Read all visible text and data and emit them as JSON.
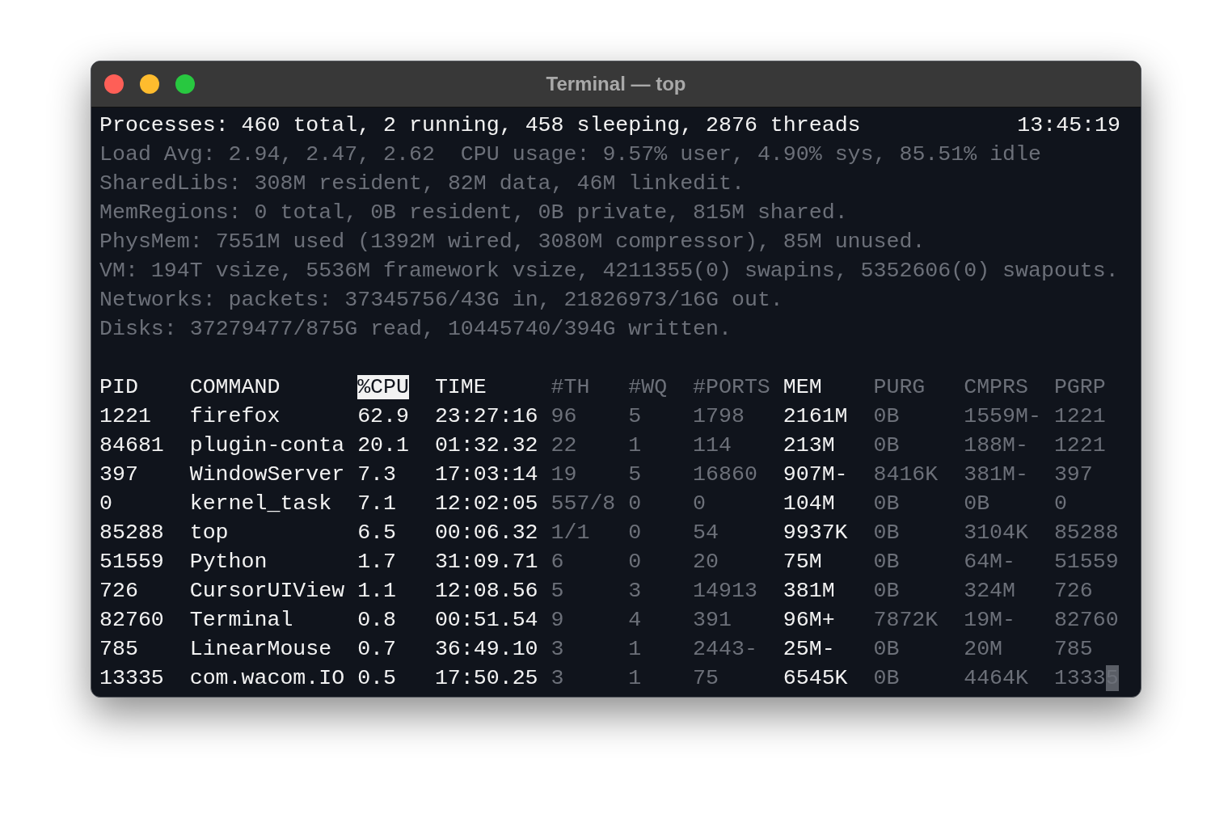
{
  "window": {
    "title": "Terminal — top"
  },
  "summary": {
    "text": "Processes: 460 total, 2 running, 458 sleeping, 2876 threads",
    "clock": "13:45:19"
  },
  "info_lines": [
    "Load Avg: 2.94, 2.47, 2.62  CPU usage: 9.57% user, 4.90% sys, 85.51% idle",
    "SharedLibs: 308M resident, 82M data, 46M linkedit.",
    "MemRegions: 0 total, 0B resident, 0B private, 815M shared.",
    "PhysMem: 7551M used (1392M wired, 3080M compressor), 85M unused.",
    "VM: 194T vsize, 5536M framework vsize, 4211355(0) swapins, 5352606(0) swapouts.",
    "Networks: packets: 37345756/43G in, 21826973/16G out.",
    "Disks: 37279477/875G read, 10445740/394G written."
  ],
  "columns": [
    {
      "label": "PID",
      "dim": false,
      "selected": false
    },
    {
      "label": "COMMAND",
      "dim": false,
      "selected": false
    },
    {
      "label": "%CPU",
      "dim": false,
      "selected": true
    },
    {
      "label": "TIME",
      "dim": false,
      "selected": false
    },
    {
      "label": "#TH",
      "dim": true,
      "selected": false
    },
    {
      "label": "#WQ",
      "dim": true,
      "selected": false
    },
    {
      "label": "#PORTS",
      "dim": true,
      "selected": false
    },
    {
      "label": "MEM",
      "dim": false,
      "selected": false
    },
    {
      "label": "PURG",
      "dim": true,
      "selected": false
    },
    {
      "label": "CMPRS",
      "dim": true,
      "selected": false
    },
    {
      "label": "PGRP",
      "dim": true,
      "selected": false
    }
  ],
  "rows": [
    [
      "1221",
      "firefox",
      "62.9",
      "23:27:16",
      "96",
      "5",
      "1798",
      "2161M",
      "0B",
      "1559M-",
      "1221"
    ],
    [
      "84681",
      "plugin-conta",
      "20.1",
      "01:32.32",
      "22",
      "1",
      "114",
      "213M",
      "0B",
      "188M-",
      "1221"
    ],
    [
      "397",
      "WindowServer",
      "7.3",
      "17:03:14",
      "19",
      "5",
      "16860",
      "907M-",
      "8416K",
      "381M-",
      "397"
    ],
    [
      "0",
      "kernel_task",
      "7.1",
      "12:02:05",
      "557/8",
      "0",
      "0",
      "104M",
      "0B",
      "0B",
      "0"
    ],
    [
      "85288",
      "top",
      "6.5",
      "00:06.32",
      "1/1",
      "0",
      "54",
      "9937K",
      "0B",
      "3104K",
      "85288"
    ],
    [
      "51559",
      "Python",
      "1.7",
      "31:09.71",
      "6",
      "0",
      "20",
      "75M",
      "0B",
      "64M-",
      "51559"
    ],
    [
      "726",
      "CursorUIView",
      "1.1",
      "12:08.56",
      "5",
      "3",
      "14913",
      "381M",
      "0B",
      "324M",
      "726"
    ],
    [
      "82760",
      "Terminal",
      "0.8",
      "00:51.54",
      "9",
      "4",
      "391",
      "96M+",
      "7872K",
      "19M-",
      "82760"
    ],
    [
      "785",
      "LinearMouse",
      "0.7",
      "36:49.10",
      "3",
      "1",
      "2443-",
      "25M-",
      "0B",
      "20M",
      "785"
    ],
    [
      "13335",
      "com.wacom.IO",
      "0.5",
      "17:50.25",
      "3",
      "1",
      "75",
      "6545K",
      "0B",
      "4464K",
      "13335"
    ]
  ],
  "cursor": {
    "visible": true
  }
}
